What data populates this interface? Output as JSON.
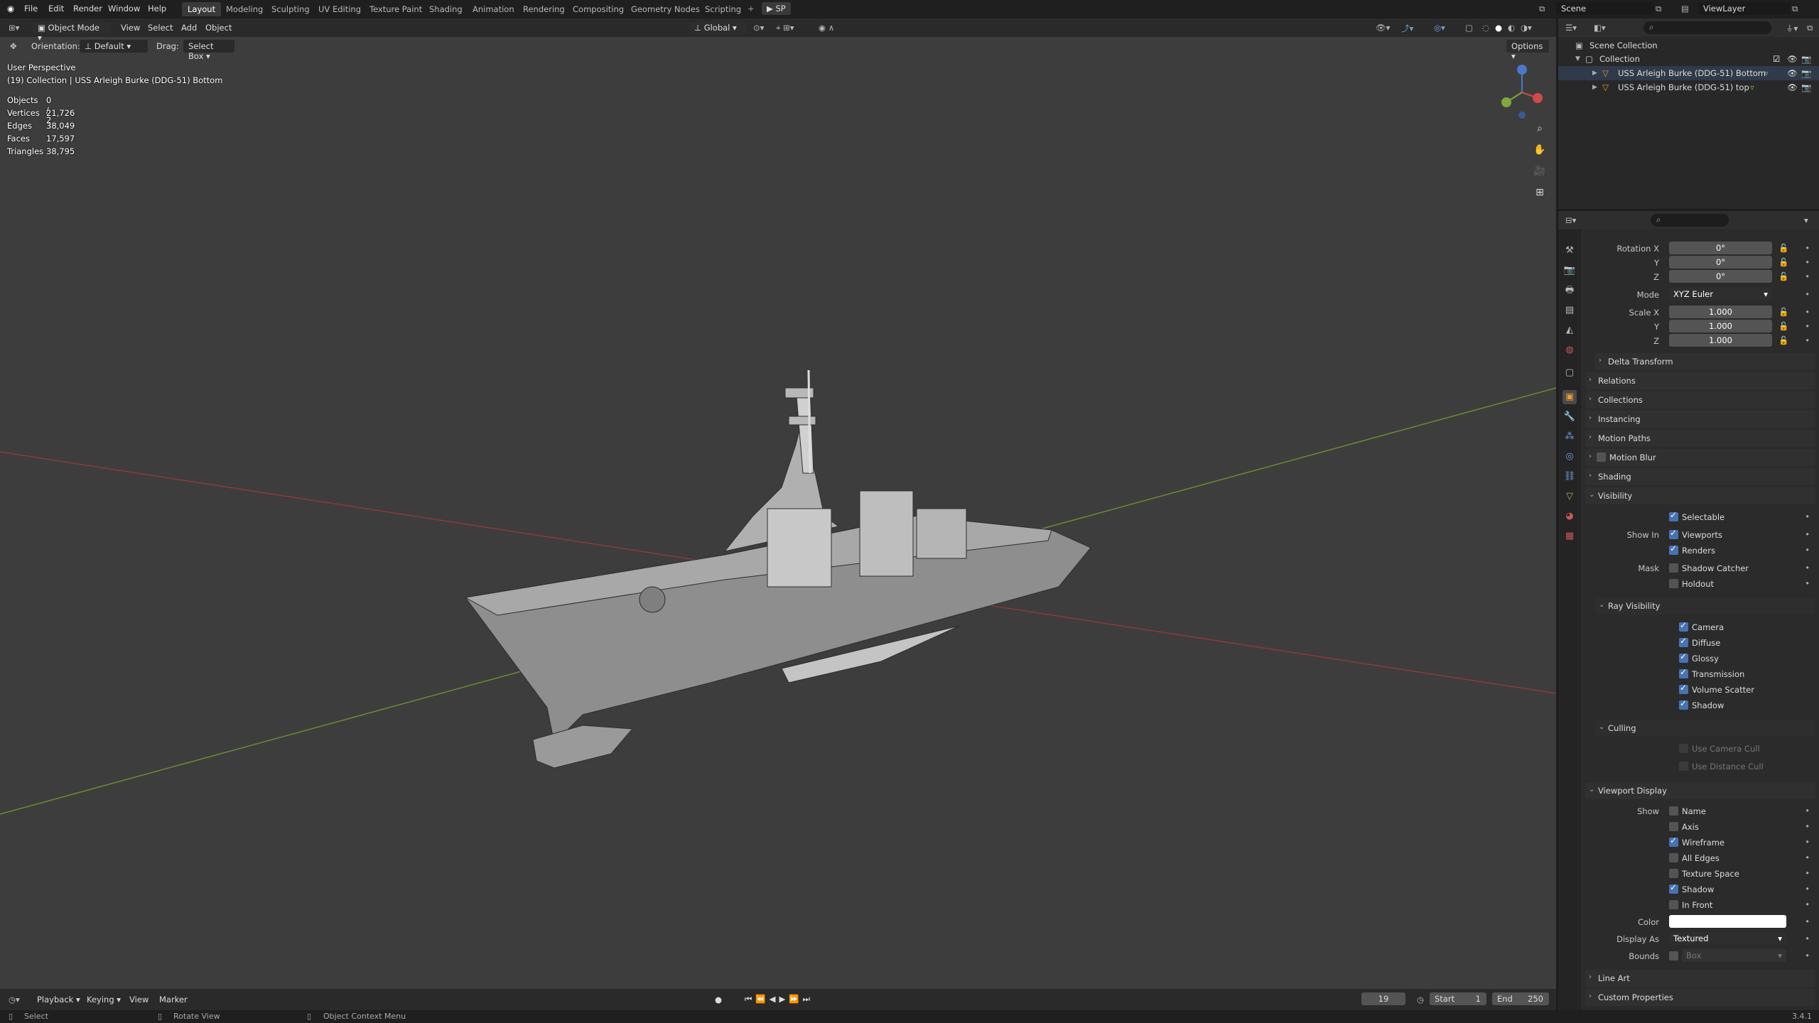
{
  "topbar": {
    "menus": [
      "File",
      "Edit",
      "Render",
      "Window",
      "Help"
    ],
    "workspaces": [
      "Layout",
      "Modeling",
      "Sculpting",
      "UV Editing",
      "Texture Paint",
      "Shading",
      "Animation",
      "Rendering",
      "Compositing",
      "Geometry Nodes",
      "Scripting"
    ],
    "active_workspace": "Layout",
    "play_label": "SP",
    "scene": "Scene",
    "view_layer": "ViewLayer"
  },
  "viewport_header": {
    "mode": "Object Mode",
    "menus": [
      "View",
      "Select",
      "Add",
      "Object"
    ],
    "transform_orientation": "Global",
    "orientation_label": "Orientation:",
    "orientation_value": "Default",
    "drag_label": "Drag:",
    "drag_value": "Select Box",
    "options": "Options"
  },
  "overlay": {
    "view_name": "User Perspective",
    "collection_info": "(19) Collection | USS Arleigh Burke (DDG-51) Bottom",
    "stats": [
      {
        "label": "Objects",
        "value": "0 / 2"
      },
      {
        "label": "Vertices",
        "value": "21,726"
      },
      {
        "label": "Edges",
        "value": "38,049"
      },
      {
        "label": "Faces",
        "value": "17,597"
      },
      {
        "label": "Triangles",
        "value": "38,795"
      }
    ]
  },
  "outliner": {
    "scene_collection": "Scene Collection",
    "collection": "Collection",
    "objects": [
      "USS Arleigh Burke (DDG-51) Bottom",
      "USS Arleigh Burke (DDG-51) top"
    ]
  },
  "properties": {
    "rotation": [
      {
        "label": "Rotation X",
        "value": "0°"
      },
      {
        "label": "Y",
        "value": "0°"
      },
      {
        "label": "Z",
        "value": "0°"
      }
    ],
    "mode_label": "Mode",
    "mode_value": "XYZ Euler",
    "scale": [
      {
        "label": "Scale X",
        "value": "1.000"
      },
      {
        "label": "Y",
        "value": "1.000"
      },
      {
        "label": "Z",
        "value": "1.000"
      }
    ],
    "sections_closed": [
      "Relations",
      "Collections",
      "Instancing",
      "Motion Paths",
      "Motion Blur",
      "Shading"
    ],
    "delta_transform": "Delta Transform",
    "visibility": "Visibility",
    "selectable": "Selectable",
    "show_in": "Show In",
    "viewports": "Viewports",
    "renders": "Renders",
    "mask": "Mask",
    "shadow_catcher": "Shadow Catcher",
    "holdout": "Holdout",
    "ray_visibility": "Ray Visibility",
    "ray_items": [
      "Camera",
      "Diffuse",
      "Glossy",
      "Transmission",
      "Volume Scatter",
      "Shadow"
    ],
    "culling": "Culling",
    "culling_items": [
      "Use Camera Cull",
      "Use Distance Cull"
    ],
    "viewport_display": "Viewport Display",
    "show": "Show",
    "show_items": [
      {
        "label": "Name",
        "on": false
      },
      {
        "label": "Axis",
        "on": false
      },
      {
        "label": "Wireframe",
        "on": true
      },
      {
        "label": "All Edges",
        "on": false
      },
      {
        "label": "Texture Space",
        "on": false
      },
      {
        "label": "Shadow",
        "on": true
      },
      {
        "label": "In Front",
        "on": false
      }
    ],
    "color_label": "Color",
    "display_as_label": "Display As",
    "display_as_value": "Textured",
    "bounds_label": "Bounds",
    "bounds_value": "Box",
    "line_art": "Line Art",
    "custom_properties": "Custom Properties"
  },
  "timeline": {
    "menus": [
      "Playback",
      "Keying",
      "View",
      "Marker"
    ],
    "current_frame": "19",
    "start_label": "Start",
    "start": "1",
    "end_label": "End",
    "end": "250"
  },
  "status": {
    "select": "Select",
    "rotate": "Rotate View",
    "context": "Object Context Menu",
    "version": "3.4.1"
  }
}
